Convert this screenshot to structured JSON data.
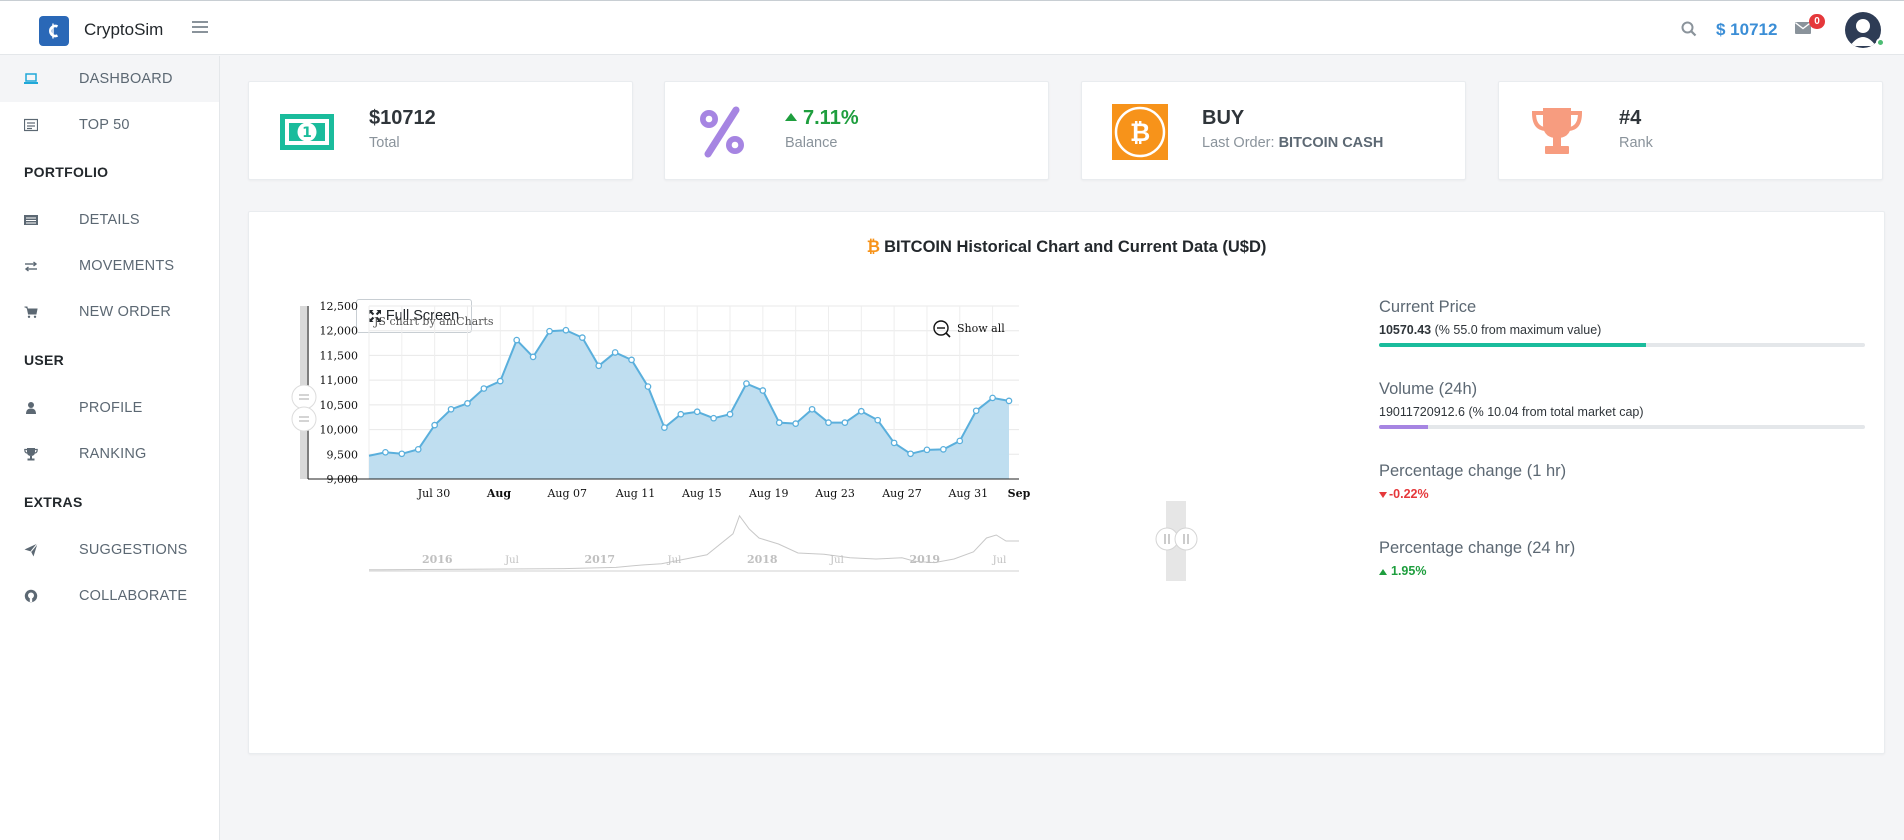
{
  "header": {
    "brand": "CryptoSim",
    "balance": "$ 10712",
    "mail_count": "0"
  },
  "sidebar": {
    "items": [
      {
        "label": "DASHBOARD",
        "icon": "laptop-icon"
      },
      {
        "label": "TOP 50",
        "icon": "list-icon"
      },
      {
        "label": "DETAILS",
        "icon": "details-icon"
      },
      {
        "label": "MOVEMENTS",
        "icon": "exchange-icon"
      },
      {
        "label": "NEW ORDER",
        "icon": "cart-icon"
      },
      {
        "label": "PROFILE",
        "icon": "user-icon"
      },
      {
        "label": "RANKING",
        "icon": "trophy-icon"
      },
      {
        "label": "SUGGESTIONS",
        "icon": "paper-plane-icon"
      },
      {
        "label": "COLLABORATE",
        "icon": "github-icon"
      }
    ],
    "sections": [
      "PORTFOLIO",
      "USER",
      "EXTRAS"
    ]
  },
  "cards": [
    {
      "title": "$10712",
      "subtitle": "Total",
      "icon": "banknote-icon",
      "color": "#1abc9c"
    },
    {
      "title": "7.11%",
      "subtitle": "Balance",
      "icon": "percent-icon",
      "color": "#a685e2"
    },
    {
      "title": "BUY",
      "subtitle_prefix": "Last Order:",
      "subtitle_value": "BITCOIN CASH",
      "icon": "bitcoin-icon",
      "color": "#f7931a"
    },
    {
      "title": "#4",
      "subtitle": "Rank",
      "icon": "trophy-icon",
      "color": "#f79c7f"
    }
  ],
  "chart_section": {
    "title": "BITCOIN Historical Chart and Current Data (U$D)",
    "fullscreen_label": "Full Screen",
    "show_all_label": "Show all",
    "credit": "JS chart by amCharts"
  },
  "metrics": {
    "current_price": {
      "label": "Current Price",
      "value": "10570.43",
      "note": "(% 55.0 from maximum value)",
      "percent": 55.0,
      "color": "#1abc9c"
    },
    "volume": {
      "label": "Volume (24h)",
      "value": "19011720912.6",
      "note": "(% 10.04 from total market cap)",
      "percent": 10.04,
      "color": "#a685e2"
    },
    "change_1h": {
      "label": "Percentage change (1 hr)",
      "value": "-0.22%"
    },
    "change_24h": {
      "label": "Percentage change (24 hr)",
      "value": "1.95%"
    }
  },
  "chart_data": {
    "type": "area",
    "title": "",
    "ylim": [
      9000,
      12500
    ],
    "y_ticks": [
      "12,500",
      "12,000",
      "11,500",
      "11,000",
      "10,500",
      "10,000",
      "9,500",
      "9,000"
    ],
    "x_ticks": [
      "Jul 30",
      "Aug",
      "Aug 07",
      "Aug 11",
      "Aug 15",
      "Aug 19",
      "Aug 23",
      "Aug 27",
      "Aug 31",
      "Sep"
    ],
    "x": [
      "Jul 26",
      "Jul 27",
      "Jul 28",
      "Jul 29",
      "Jul 30",
      "Jul 31",
      "Aug 01",
      "Aug 02",
      "Aug 03",
      "Aug 04",
      "Aug 05",
      "Aug 06",
      "Aug 07",
      "Aug 08",
      "Aug 09",
      "Aug 10",
      "Aug 11",
      "Aug 12",
      "Aug 13",
      "Aug 14",
      "Aug 15",
      "Aug 16",
      "Aug 17",
      "Aug 18",
      "Aug 19",
      "Aug 20",
      "Aug 21",
      "Aug 22",
      "Aug 23",
      "Aug 24",
      "Aug 25",
      "Aug 26",
      "Aug 27",
      "Aug 28",
      "Aug 29",
      "Aug 30",
      "Aug 31",
      "Sep 01",
      "Sep 02"
    ],
    "values": [
      9470,
      9540,
      9510,
      9600,
      10090,
      10410,
      10530,
      10830,
      10980,
      11810,
      11470,
      11990,
      12010,
      11860,
      11290,
      11560,
      11410,
      10870,
      10040,
      10310,
      10360,
      10230,
      10310,
      10930,
      10790,
      10140,
      10120,
      10410,
      10140,
      10140,
      10370,
      10190,
      9730,
      9510,
      9590,
      9600,
      9770,
      10380,
      10640,
      10580
    ],
    "navigator_labels": [
      "2016",
      "Jul",
      "2017",
      "Jul",
      "2018",
      "Jul",
      "2019",
      "Jul"
    ]
  }
}
